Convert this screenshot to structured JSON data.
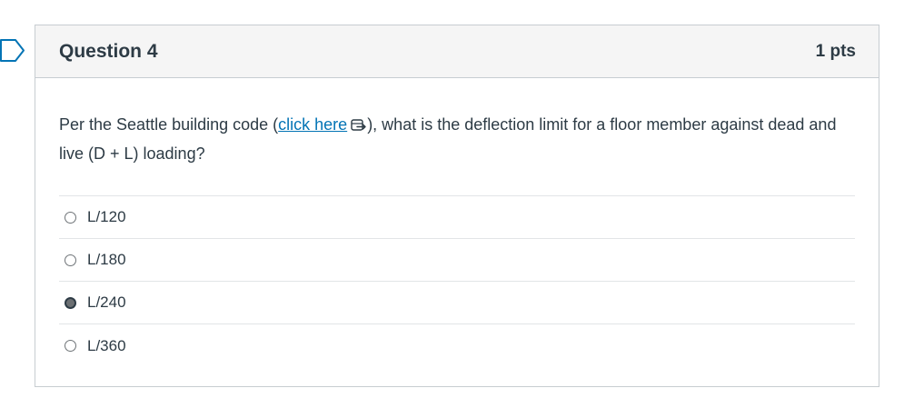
{
  "question": {
    "title": "Question 4",
    "points": "1 pts",
    "text_before_link": "Per the Seattle building code (",
    "link_text": "click here",
    "text_after_link": "), what is the deflection limit for a floor member against dead and live (D + L) loading?"
  },
  "answers": [
    {
      "label": "L/120",
      "selected": false
    },
    {
      "label": "L/180",
      "selected": false
    },
    {
      "label": "L/240",
      "selected": true
    },
    {
      "label": "L/360",
      "selected": false
    }
  ],
  "colors": {
    "link": "#0374b5",
    "flag": "#0374b5",
    "header_bg": "#f5f5f5",
    "border": "#c7cdd1"
  },
  "icons": {
    "flag": "bookmark-flag-icon",
    "external_link": "external-link-icon"
  }
}
